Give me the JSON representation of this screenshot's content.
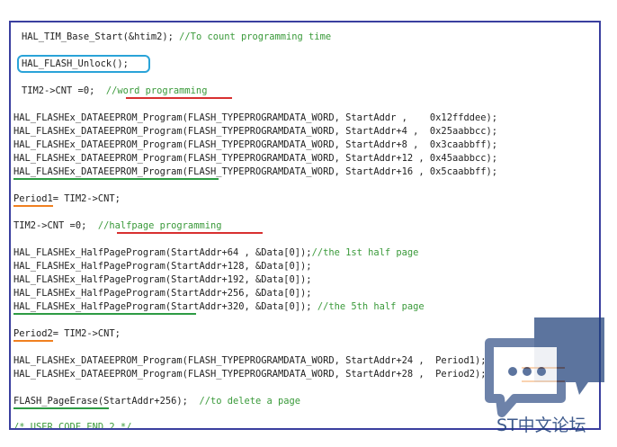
{
  "code": {
    "l01": {
      "pre": "HAL_TIM_Base_Start(&htim2); ",
      "comment": "//To count programming time"
    },
    "l02": "HAL_FLASH_Unlock();",
    "l03": {
      "pre": "TIM2->CNT =0;  ",
      "comment": "//word programming"
    },
    "l04": "HAL_FLASHEx_DATAEEPROM_Program(FLASH_TYPEPROGRAMDATA_WORD, StartAddr ,    0x12ffddee);",
    "l05": "HAL_FLASHEx_DATAEEPROM_Program(FLASH_TYPEPROGRAMDATA_WORD, StartAddr+4 ,  0x25aabbcc);",
    "l06": "HAL_FLASHEx_DATAEEPROM_Program(FLASH_TYPEPROGRAMDATA_WORD, StartAddr+8 ,  0x3caabbff);",
    "l07": "HAL_FLASHEx_DATAEEPROM_Program(FLASH_TYPEPROGRAMDATA_WORD, StartAddr+12 , 0x45aabbcc);",
    "l08": "HAL_FLASHEx_DATAEEPROM_Program(FLASH_TYPEPROGRAMDATA_WORD, StartAddr+16 , 0x5caabbff);",
    "l09": "Period1= TIM2->CNT;",
    "l10": {
      "pre": "TIM2->CNT =0;  ",
      "comment": "//halfpage programming"
    },
    "l11": {
      "pre": "HAL_FLASHEx_HalfPageProgram(StartAddr+64 , &Data[0]);",
      "comment": "//the 1st half page"
    },
    "l12": "HAL_FLASHEx_HalfPageProgram(StartAddr+128, &Data[0]);",
    "l13": "HAL_FLASHEx_HalfPageProgram(StartAddr+192, &Data[0]);",
    "l14": "HAL_FLASHEx_HalfPageProgram(StartAddr+256, &Data[0]);",
    "l15": {
      "pre": "HAL_FLASHEx_HalfPageProgram(StartAddr+320, &Data[0]); ",
      "comment": "//the 5th half page"
    },
    "l16": "Period2= TIM2->CNT;",
    "l17": "HAL_FLASHEx_DATAEEPROM_Program(FLASH_TYPEPROGRAMDATA_WORD, StartAddr+24 ,  Period1);",
    "l18": "HAL_FLASHEx_DATAEEPROM_Program(FLASH_TYPEPROGRAMDATA_WORD, StartAddr+28 ,  Period2);",
    "l19": {
      "pre": "FLASH_PageErase(StartAddr+256);  ",
      "comment": "//to delete a page"
    },
    "l20": {
      "comment": "/* USER CODE END 2 */"
    }
  },
  "colors": {
    "comment": "#3a9a3a",
    "frame": "#3a3f9f",
    "highlight_box": "#2aa3d8",
    "underline_red": "#d83030",
    "underline_green": "#2e9b44",
    "underline_orange": "#f08020"
  },
  "watermark": {
    "text": "ST中文论坛",
    "logo_icon": "speech-bubble-logo-icon"
  }
}
